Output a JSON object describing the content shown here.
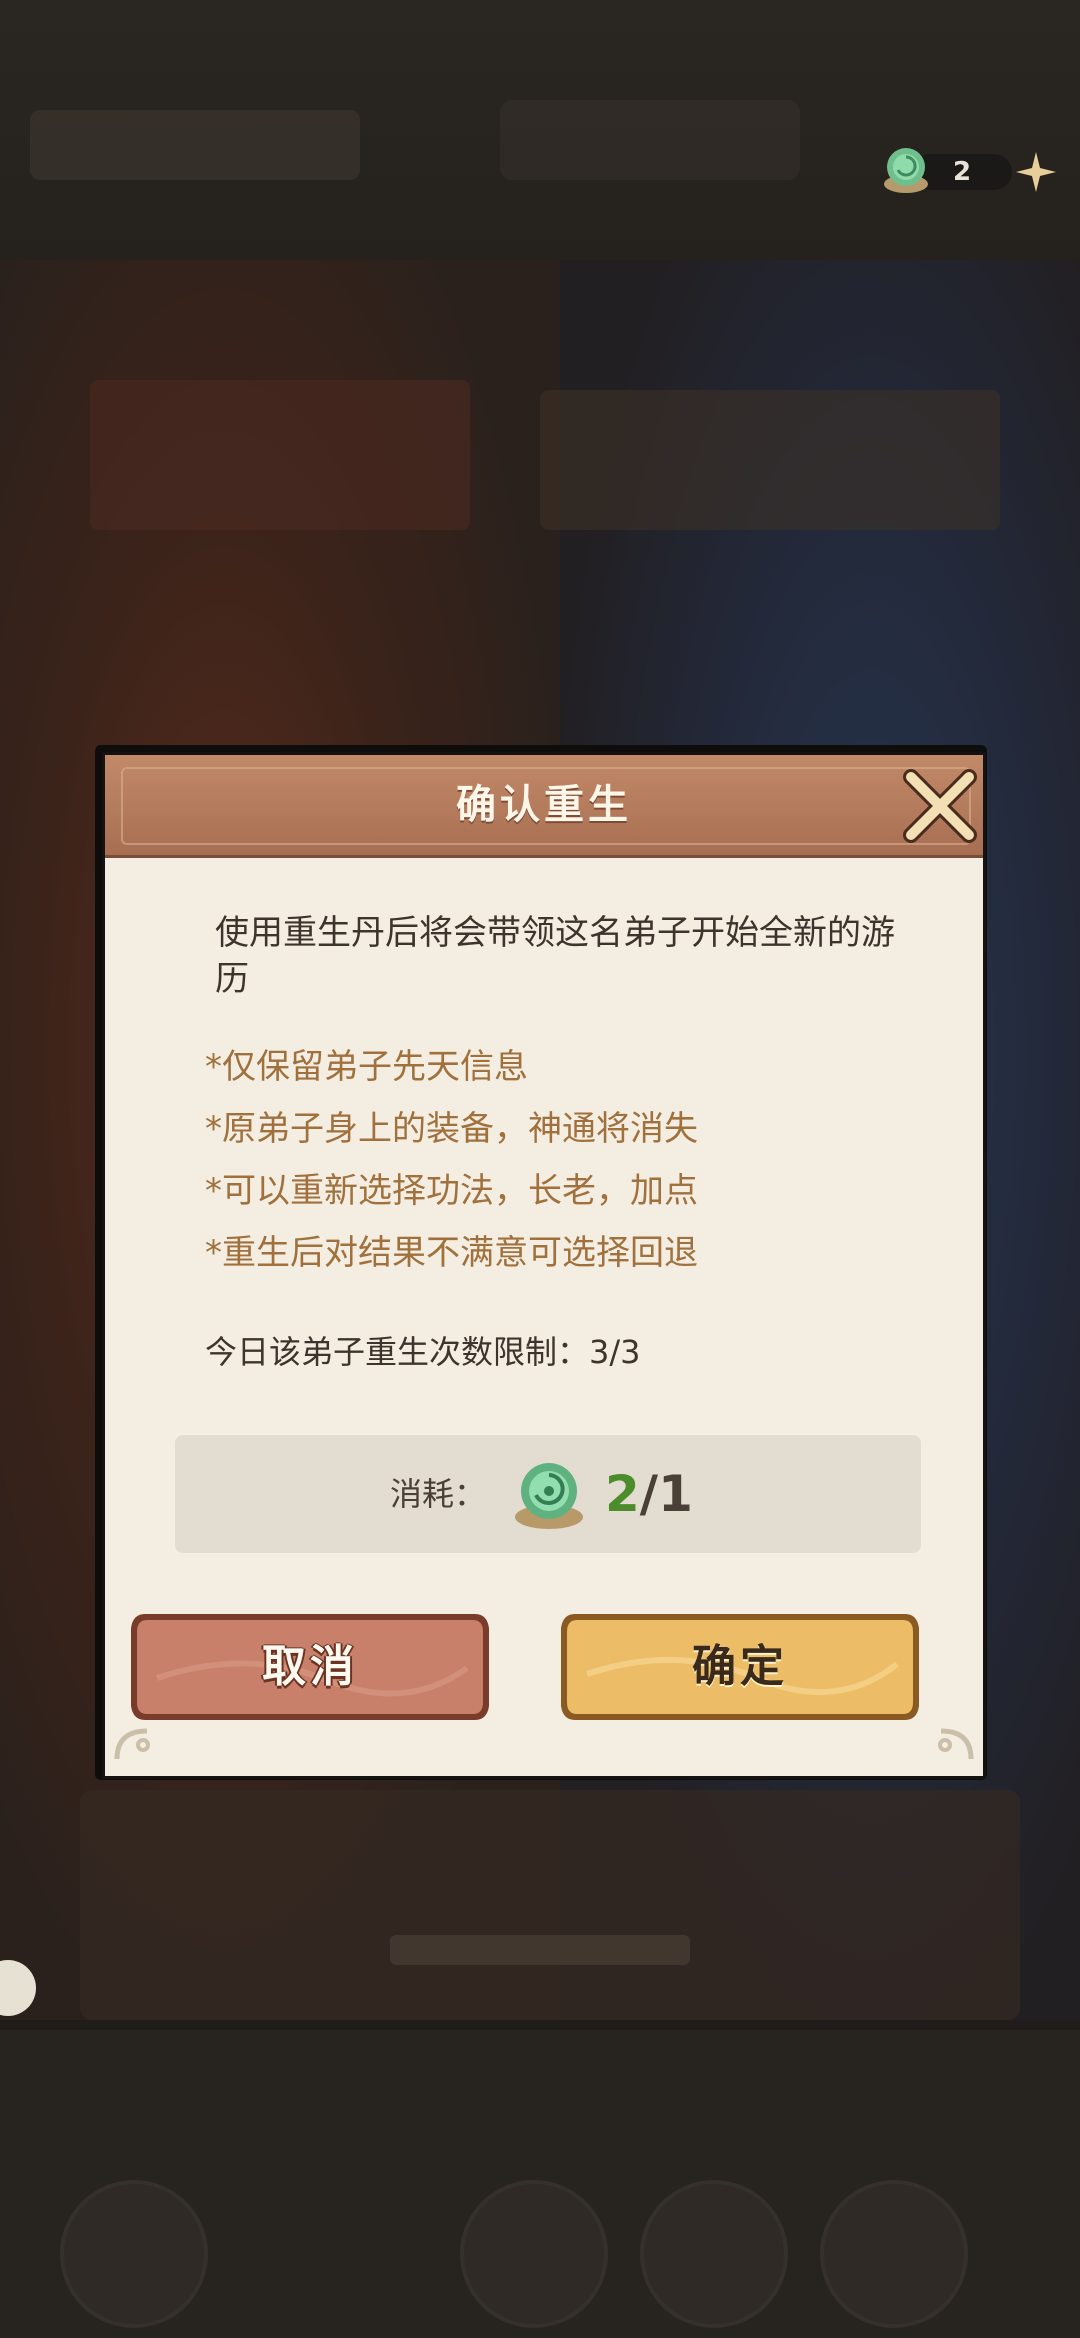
{
  "currency": {
    "amount": "2",
    "icon": "rebirth-pill-icon",
    "add_icon": "plus-icon"
  },
  "dialog": {
    "title": "确认重生",
    "description": "使用重生丹后将会带领这名弟子开始全新的游历",
    "notes": [
      "*仅保留弟子先天信息",
      "*原弟子身上的装备，神通将消失",
      "*可以重新选择功法，长老，加点",
      "*重生后对结果不满意可选择回退"
    ],
    "limit_text": "今日该弟子重生次数限制：3/3",
    "cost": {
      "label": "消耗：",
      "have": "2",
      "sep": "/",
      "need": "1",
      "icon": "rebirth-pill-icon"
    },
    "buttons": {
      "cancel": "取消",
      "confirm": "确定"
    }
  },
  "colors": {
    "header": "#b27859",
    "note_text": "#a0703d",
    "have_value": "#4c8c2a",
    "cancel": "#c47b63",
    "confirm": "#e9b864"
  }
}
